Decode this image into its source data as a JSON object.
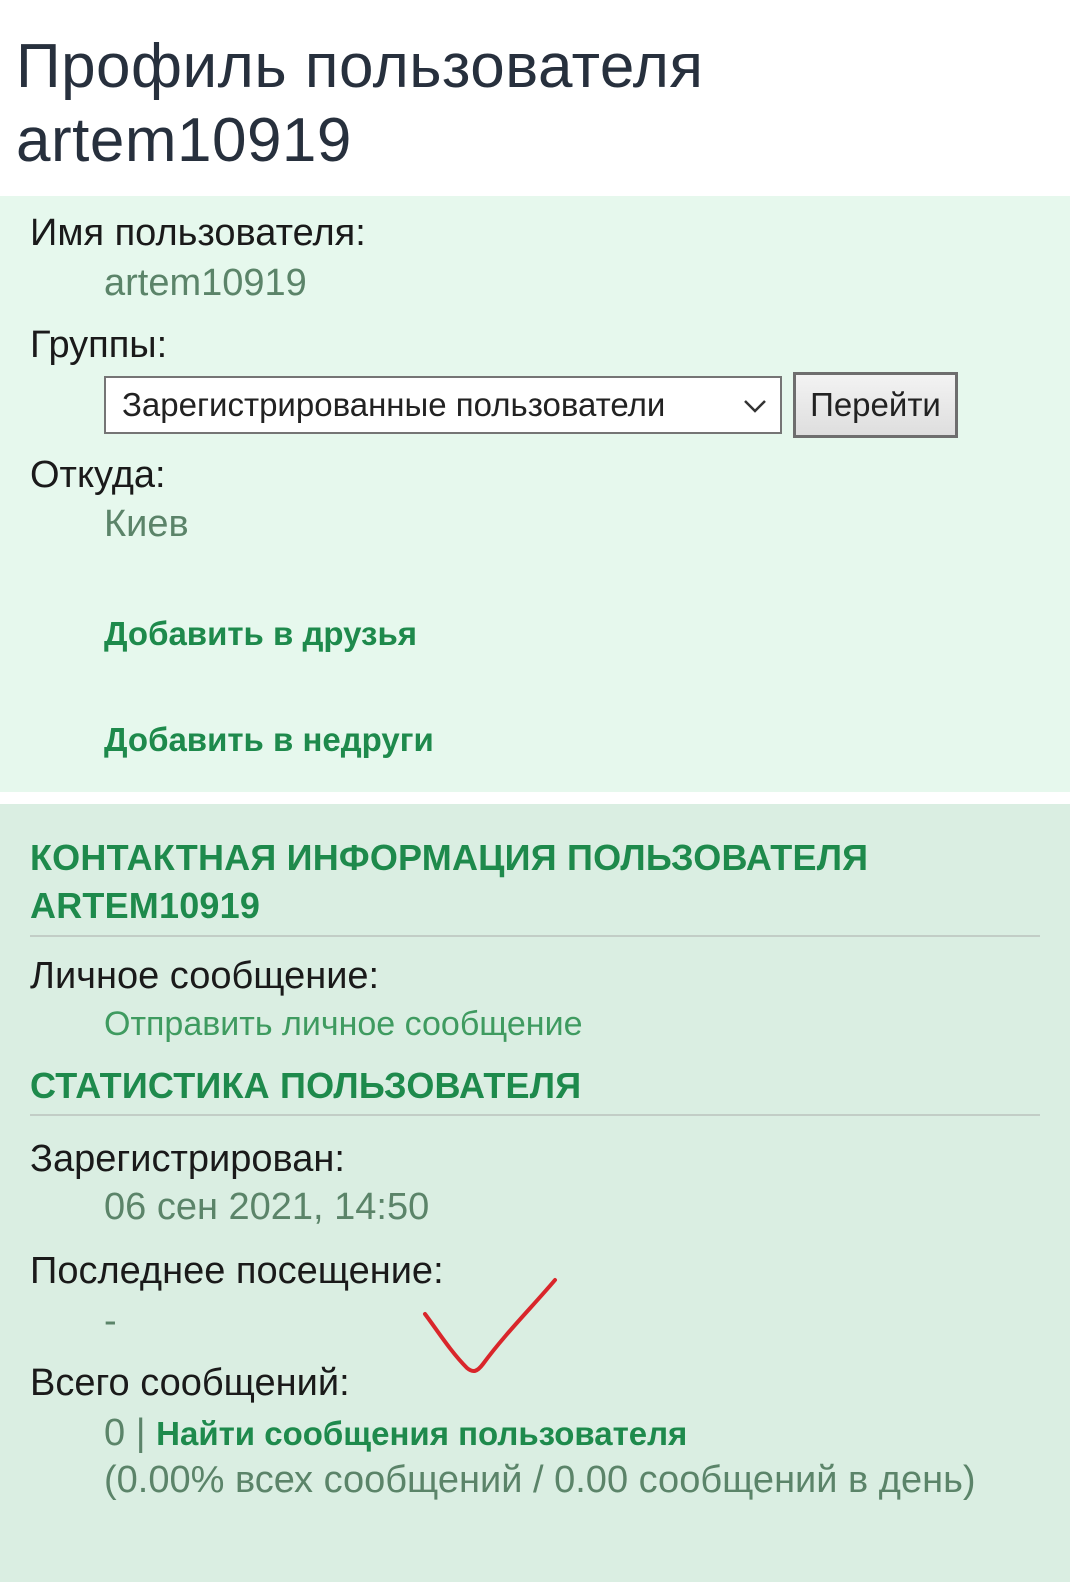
{
  "page": {
    "title": "Профиль пользователя artem10919"
  },
  "profile": {
    "username_label": "Имя пользователя:",
    "username_value": "artem10919",
    "groups_label": "Группы:",
    "groups_selected": "Зарегистрированные пользователи",
    "go_button": "Перейти",
    "location_label": "Откуда:",
    "location_value": "Киев",
    "add_friend": "Добавить в друзья",
    "add_foe": "Добавить в недруги"
  },
  "contact": {
    "heading": "КОНТАКТНАЯ ИНФОРМАЦИЯ ПОЛЬЗОВАТЕЛЯ ARTEM10919",
    "pm_label": "Личное сообщение:",
    "pm_link": "Отправить личное сообщение"
  },
  "stats": {
    "heading": "СТАТИСТИКА ПОЛЬЗОВАТЕЛЯ",
    "registered_label": "Зарегистрирован:",
    "registered_value": "06 сен 2021, 14:50",
    "last_visit_label": "Последнее посещение:",
    "last_visit_value": "-",
    "total_posts_label": "Всего сообщений:",
    "total_posts_count": "0",
    "total_posts_sep": " | ",
    "find_posts_link": "Найти сообщения пользователя",
    "posts_ratio": "(0.00% всех сообщений / 0.00 сообщений в день)"
  },
  "colors": {
    "panel_top": "#e6f8ed",
    "panel_bottom": "#daeee2",
    "accent_green": "#1e8a4c",
    "value_green": "#5b8469",
    "annotation_red": "#d9262b"
  },
  "annotations": {
    "checkmark_icon": "red-handdrawn-checkmark"
  }
}
